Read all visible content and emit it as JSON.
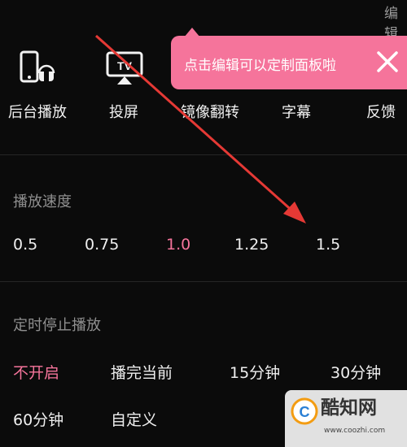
{
  "header": {
    "edit_label": "编辑"
  },
  "toolbar": {
    "items": [
      {
        "label": "后台播放",
        "icon": "phone-headphones-icon"
      },
      {
        "label": "投屏",
        "icon": "tv-cast-icon"
      },
      {
        "label": "镜像翻转",
        "icon": "mirror-icon"
      },
      {
        "label": "字幕",
        "icon": "subtitle-icon"
      },
      {
        "label": "反馈",
        "icon": "feedback-icon"
      }
    ]
  },
  "tooltip": {
    "text": "点击编辑可以定制面板啦",
    "color": "#f5749b"
  },
  "speed": {
    "title": "播放速度",
    "options": [
      "0.5",
      "0.75",
      "1.0",
      "1.25",
      "1.5"
    ],
    "selected": "1.0"
  },
  "timer": {
    "title": "定时停止播放",
    "options": [
      "不开启",
      "播完当前",
      "15分钟",
      "30分钟",
      "60分钟",
      "自定义"
    ],
    "selected": "不开启"
  },
  "watermark": {
    "title": "酷知网",
    "url": "www.coozhi.com",
    "logo_text": "C"
  },
  "colors": {
    "accent": "#f5749b",
    "annotation": "#e53935"
  }
}
